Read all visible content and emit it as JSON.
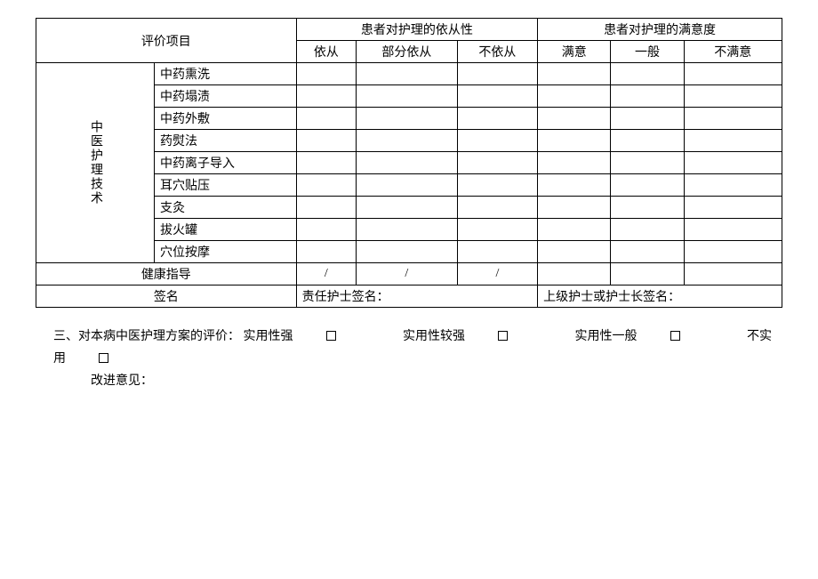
{
  "table": {
    "header": {
      "item": "评价项目",
      "compliance": "患者对护理的依从性",
      "satisfaction": "患者对护理的满意度",
      "compliance_cols": [
        "依从",
        "部分依从",
        "不依从"
      ],
      "satisfaction_cols": [
        "满意",
        "一般",
        "不满意"
      ]
    },
    "group_label": "中医护理技术",
    "rows": [
      "中药熏洗",
      "中药塌渍",
      "中药外敷",
      "药熨法",
      "中药离子导入",
      "耳穴贴压",
      "支灸",
      "拔火罐",
      "穴位按摩"
    ],
    "health_guidance": "健康指导",
    "slash": "/",
    "signature_label": "签名",
    "responsible_nurse": "责任护士签名：",
    "senior_nurse": "上级护士或护士长签名："
  },
  "evaluation": {
    "prefix": "三、",
    "title": "对本病中医护理方案的评价：",
    "options": [
      "实用性强",
      "实用性较强",
      "实用性一般",
      "不实用"
    ],
    "improvement": "改进意见："
  }
}
